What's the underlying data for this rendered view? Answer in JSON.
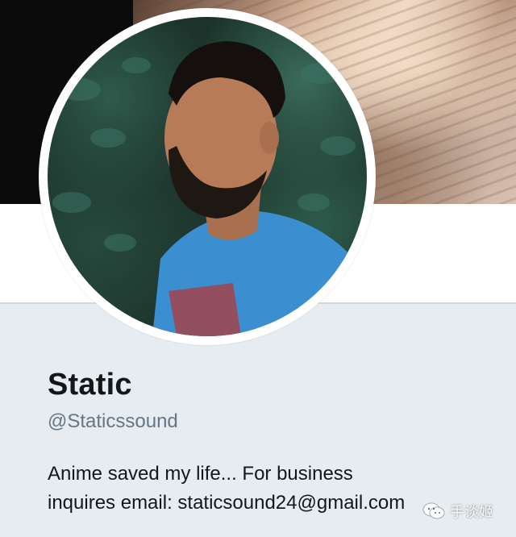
{
  "profile": {
    "display_name": "Static",
    "handle": "@Staticssound",
    "bio_lines": [
      "Anime saved my life... For business",
      "inquires email: staticsound24@gmail.com"
    ]
  },
  "watermark": {
    "text": "手谈姬"
  },
  "icons": {
    "watermark_logo": "wechat-logo-icon"
  },
  "colors": {
    "name": "#14171a",
    "handle": "#657786",
    "panel_bg": "#e6ecf0",
    "banner_dark": "#0b0b0b"
  }
}
